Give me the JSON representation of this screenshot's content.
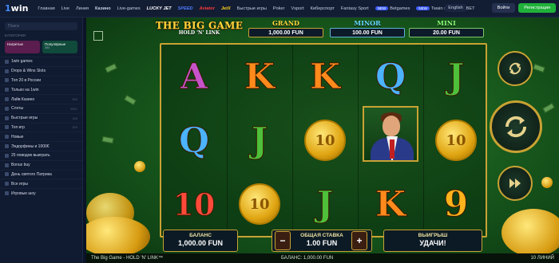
{
  "header": {
    "logo_a": "1",
    "logo_b": "win",
    "nav": [
      {
        "label": "Главная",
        "active": false
      },
      {
        "label": "Live",
        "active": false
      },
      {
        "label": "Линия",
        "active": false
      },
      {
        "label": "Казино",
        "active": true
      },
      {
        "label": "Live-games",
        "active": false
      },
      {
        "label": "LUCKY JET",
        "active": false,
        "brand": true,
        "color": "#ffffff"
      },
      {
        "label": "SPEED",
        "active": false,
        "brand": true,
        "color": "#4f7bff"
      },
      {
        "label": "Aviator",
        "active": false,
        "brand": true,
        "color": "#ff3b3b"
      },
      {
        "label": "JetX",
        "active": false,
        "brand": true,
        "color": "#ffd21c"
      },
      {
        "label": "Быстрые игры",
        "active": false
      },
      {
        "label": "Poker",
        "active": false
      },
      {
        "label": "Vsport",
        "active": false
      },
      {
        "label": "Киберспорт",
        "active": false
      },
      {
        "label": "Fantasy Sport",
        "active": false
      },
      {
        "label": "Betgames",
        "active": false,
        "badge": "NEW"
      },
      {
        "label": "Twain sport",
        "active": false,
        "badge": "NEW"
      },
      {
        "label": "TVBET",
        "active": false
      }
    ],
    "language": "English",
    "login": "Войти",
    "register": "Регистрация"
  },
  "sidebar": {
    "search_placeholder": "Поиск",
    "categories_label": "КАТЕГОРИИ",
    "cards": [
      {
        "label": "Нагретые",
        "sub": ""
      },
      {
        "label": "Популярные",
        "sub": "350"
      }
    ],
    "items": [
      {
        "label": "1win games",
        "count": ""
      },
      {
        "label": "Drops & Wins Slots",
        "count": ""
      },
      {
        "label": "Топ 20 в России",
        "count": ""
      },
      {
        "label": "Только на 1win",
        "count": ""
      },
      {
        "label": "Лайв Казино",
        "count": "354"
      },
      {
        "label": "Слоты",
        "count": "9837"
      },
      {
        "label": "Быстрые игры",
        "count": "165"
      },
      {
        "label": "Топ игр",
        "count": "300"
      },
      {
        "label": "Новые",
        "count": ""
      },
      {
        "label": "Эндорфины и 1000€",
        "count": ""
      },
      {
        "label": "25 поводов выиграть",
        "count": ""
      },
      {
        "label": "Bonus buy",
        "count": ""
      },
      {
        "label": "День святого Патрика",
        "count": ""
      },
      {
        "label": "Все игры",
        "count": ""
      },
      {
        "label": "Игровые шоу",
        "count": ""
      }
    ]
  },
  "game": {
    "title_line1": "THE BIG GAME",
    "title_line2": "HOLD 'N' LINK",
    "jackpots": {
      "grand": {
        "label": "GRAND",
        "value": "1,000.00 FUN"
      },
      "minor": {
        "label": "MINOR",
        "value": "100.00 FUN"
      },
      "mini": {
        "label": "MINI",
        "value": "20.00 FUN"
      }
    },
    "coin_value": "10",
    "symbols": {
      "a": "A",
      "k": "K",
      "q": "Q",
      "j": "J",
      "ten": "10",
      "nine": "9"
    },
    "balance": {
      "label": "БАЛАНС",
      "value": "1,000.00 FUN"
    },
    "bet": {
      "label": "ОБЩАЯ СТАВКА",
      "value": "1.00 FUN",
      "minus": "−",
      "plus": "+"
    },
    "win": {
      "label": "ВЫИГРЫШ",
      "value": "УДАЧИ!"
    },
    "footer_title": "The Big Game - HOLD 'N' LINK™",
    "footer_balance": "БАЛАНС: 1,000.00 FUN",
    "footer_lines": "10 ЛИНИЙ"
  },
  "colors": {
    "accent_green": "#1fb13a",
    "gold": "#c9a233",
    "nav_bg": "#121c33"
  }
}
